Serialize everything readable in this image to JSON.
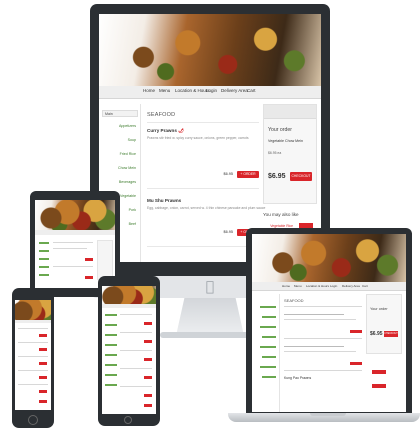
{
  "desktop": {
    "nav": [
      "Home",
      "Menu",
      "Location & Hours",
      "Login",
      "Delivery Area",
      "Cart"
    ],
    "sidebar_header": "Main",
    "sidebar_items": [
      "Appetizers",
      "Soup",
      "Fried Rice",
      "Chow Mein",
      "Beverages",
      "Vegetable",
      "Pork",
      "Beef"
    ],
    "section_title": "SEAFOOD",
    "items": [
      {
        "name": "Curry Prawns",
        "desc": "Prawns stir fried w. spicy curry sauce, onions, green pepper, carrots",
        "price": "$6.95",
        "button": "+ ORDER"
      },
      {
        "name": "Mu Shu Prawns",
        "desc": "Egg, cabbage, onion, carrot, served w. 4 thin chinese pancake and plum sauce",
        "price": "$6.95",
        "button": "+ ORDER"
      }
    ],
    "order": {
      "title": "Your order",
      "item": "Vegetable Chow Mein",
      "item_price": "$6.95 ea",
      "total": "$6.95",
      "checkout": "CHECKOUT",
      "also_like": "You may also like",
      "also_item": "Vegetable Rice"
    }
  },
  "laptop": {
    "nav": [
      "Home",
      "Menu",
      "Location & Hours",
      "Login",
      "Delivery Area",
      "Cart"
    ],
    "section_title": "SEAFOOD",
    "order_title": "Your order",
    "total": "$6.95",
    "checkout": "CHECKOUT",
    "item3": "Kung Pao Prawns"
  },
  "colors": {
    "accent_red": "#d9252a",
    "device_frame": "#2b2f33",
    "link_green": "#3a7a2a"
  },
  "icons": [
    "apple-logo-icon",
    "pepper-icon"
  ]
}
